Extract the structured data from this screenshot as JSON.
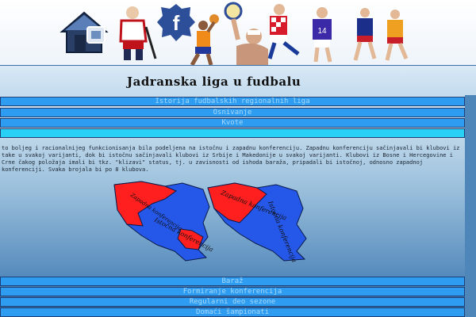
{
  "header": {
    "title": "Jadranska liga u fudbalu"
  },
  "banner": {
    "icons": [
      "home-icon",
      "hockey-player-icon",
      "facebook-icon",
      "basketball-player-icon",
      "water-polo-icon",
      "football-player-icon",
      "volleyball-player-icon",
      "handball-player-icon"
    ],
    "facebook_glyph": "f"
  },
  "menu_top": [
    {
      "label": "Istorija fudbalskih regionalnih liga"
    },
    {
      "label": "Osnivanje"
    },
    {
      "label": "Kvote"
    },
    {
      "label": ""
    }
  ],
  "content": {
    "paragraph": "to boljeg i racionalnijeg funkcionisanja bila podeljena na istočnu i zapadnu konferenciju. Zapadnu konferenciju sačinjavali bi klubovi iz take u svakoj varijanti, dok bi istočnu sačinjavali klubovi iz Srbije i Makedonije u svakoj varijanti. Klubovi iz Bosne i Hercegovine i Crne čakog položaja imali bi tkz. \"klizavi\" status, tj. u zavisnosti od ishoda baraža, pripadali bi istočnoj, odnosno zapadnoj konferenciji. Svaka brojala bi po 8 klubova."
  },
  "map": {
    "left_west_label": "Zapadna konferencija",
    "left_east_label": "Istočna konferencija",
    "right_west_label": "Zapadna konferencija",
    "right_east_label": "Istočna konferencija",
    "west_color": "#ff1f1f",
    "east_color": "#2558e8"
  },
  "menu_bottom": [
    {
      "label": "Baraž"
    },
    {
      "label": "Formiranje konferencija"
    },
    {
      "label": "Regularni deo sezone"
    },
    {
      "label": "Domaći šampionati"
    }
  ],
  "colors": {
    "menu_blue": "#2e9cf0",
    "menu_cyan": "#27d0f4",
    "menu_text": "#a7daff"
  }
}
